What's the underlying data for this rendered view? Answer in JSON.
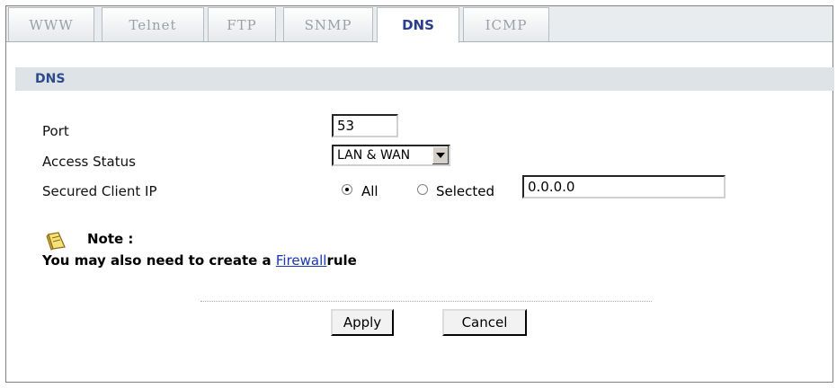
{
  "tabs": [
    {
      "label": "WWW",
      "active": false
    },
    {
      "label": "Telnet",
      "active": false
    },
    {
      "label": "FTP",
      "active": false
    },
    {
      "label": "SNMP",
      "active": false
    },
    {
      "label": "DNS",
      "active": true
    },
    {
      "label": "ICMP",
      "active": false
    }
  ],
  "section": {
    "title": "DNS"
  },
  "form": {
    "port_label": "Port",
    "port_value": "53",
    "access_status_label": "Access Status",
    "access_status_value": "LAN & WAN",
    "secured_client_ip_label": "Secured Client IP",
    "radio_all_label": "All",
    "radio_selected_label": "Selected",
    "selected_ip_value": "0.0.0.0"
  },
  "note": {
    "title": "Note :",
    "text_before": "You may also need to create a ",
    "link_text": "Firewall",
    "text_after": "rule"
  },
  "buttons": {
    "apply": "Apply",
    "cancel": "Cancel"
  },
  "colors": {
    "active_tab": "#2a3c8c",
    "section_header_bg": "#dde3e7",
    "link": "#1a36b0"
  }
}
